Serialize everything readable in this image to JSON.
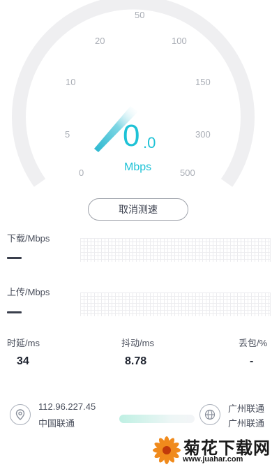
{
  "gauge": {
    "ticks": [
      "0",
      "5",
      "10",
      "20",
      "50",
      "100",
      "150",
      "300",
      "500"
    ],
    "speed_integer": "0",
    "speed_decimal": ".0",
    "unit": "Mbps",
    "accent_color": "#1ec2d6",
    "needle_icon": "gauge-needle-icon"
  },
  "cancel_button": {
    "label": "取消测速"
  },
  "download": {
    "label": "下载/Mbps",
    "value": "—"
  },
  "upload": {
    "label": "上传/Mbps",
    "value": "—"
  },
  "metrics": {
    "latency": {
      "label": "时延/ms",
      "value": "34"
    },
    "jitter": {
      "label": "抖动/ms",
      "value": "8.78"
    },
    "loss": {
      "label": "丢包/%",
      "value": "-"
    }
  },
  "client": {
    "icon": "location-pin-icon",
    "ip": "112.96.227.45",
    "isp": "中国联通"
  },
  "server": {
    "icon": "globe-icon",
    "line1": "广州联通",
    "line2": "广州联通"
  },
  "watermark": {
    "title": "菊花下载网",
    "url": "www.juahar.com"
  }
}
